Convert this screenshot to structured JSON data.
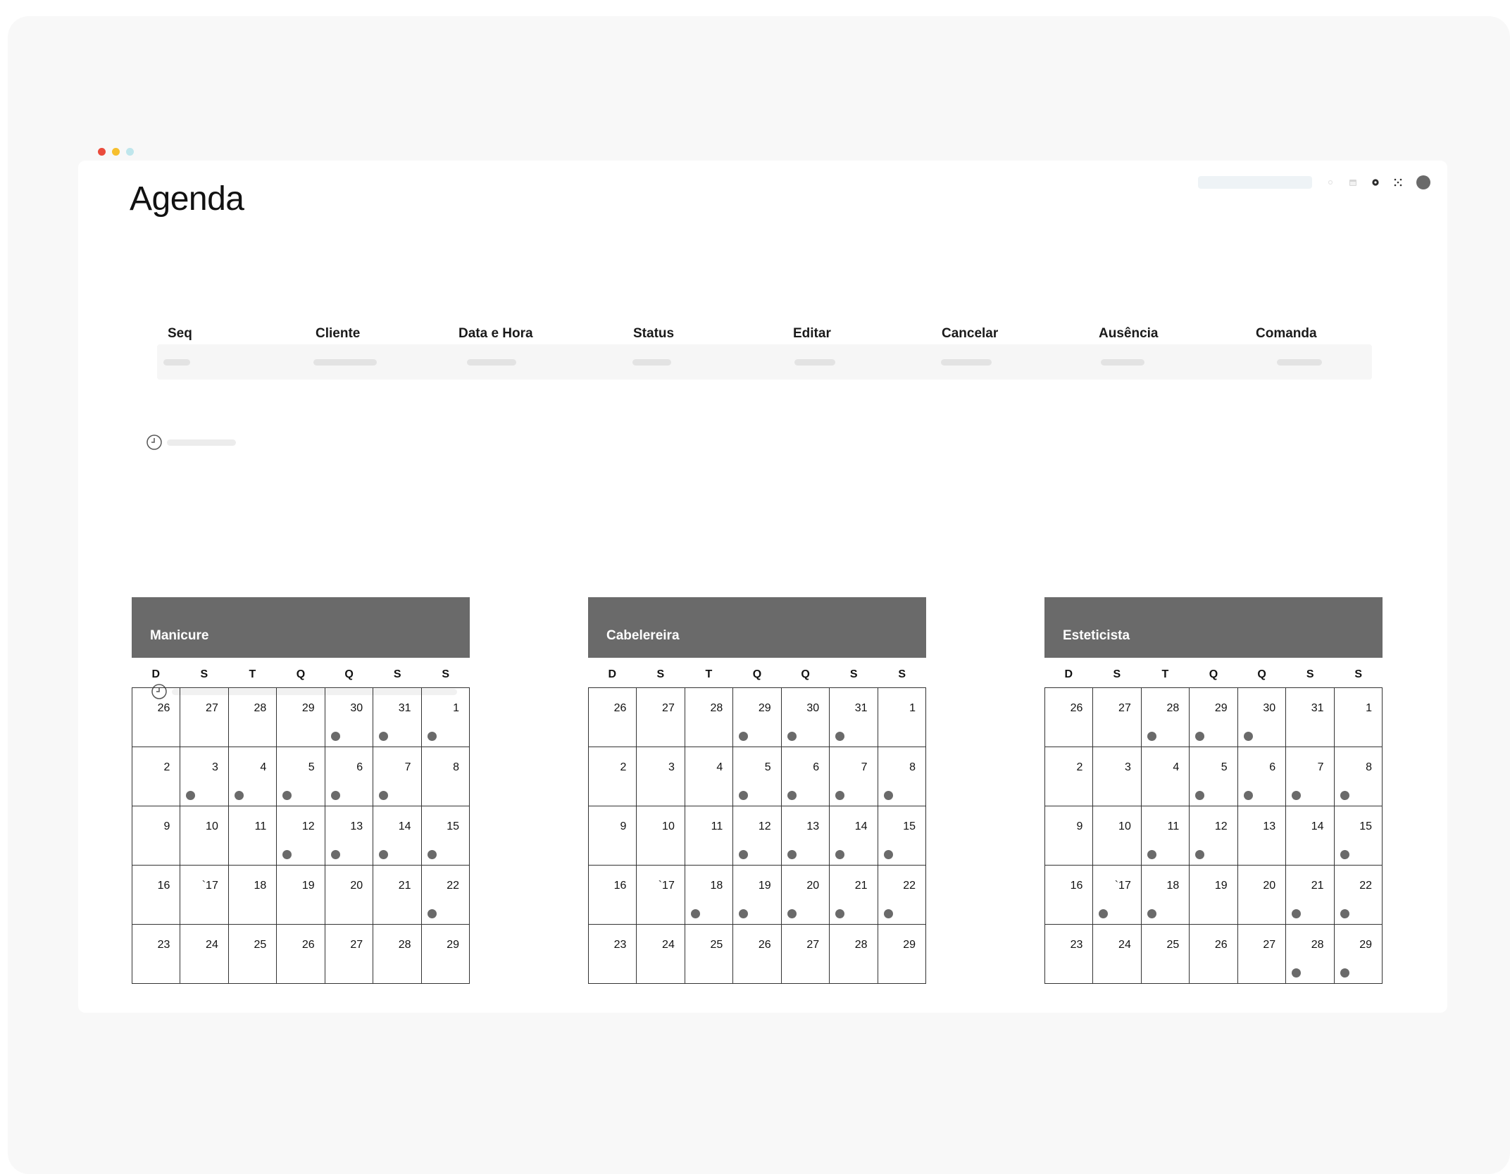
{
  "window": {
    "traffic_lights": [
      "#ea4b3c",
      "#f6bf2e",
      "#bfe6ec"
    ]
  },
  "toolbar": {
    "icons": [
      "sun-icon",
      "calendar-icon",
      "gear-icon",
      "expand-icon"
    ],
    "accent": "#6a6a6a"
  },
  "page": {
    "title": "Agenda"
  },
  "appointments": {
    "columns": [
      "Seq",
      "Cliente",
      "Data e Hora",
      "Status",
      "Editar",
      "Cancelar",
      "Ausência",
      "Comanda"
    ]
  },
  "calendars": [
    {
      "title": "Manicure",
      "weekdays": [
        "D",
        "S",
        "T",
        "Q",
        "Q",
        "S",
        "S"
      ],
      "days": [
        "26",
        "27",
        "28",
        "29",
        "30",
        "31",
        "1",
        "2",
        "3",
        "4",
        "5",
        "6",
        "7",
        "8",
        "9",
        "10",
        "11",
        "12",
        "13",
        "14",
        "15",
        "16",
        "`17",
        "18",
        "19",
        "20",
        "21",
        "22",
        "23",
        "24",
        "25",
        "26",
        "27",
        "28",
        "29"
      ],
      "marked": [
        false,
        false,
        false,
        false,
        true,
        true,
        true,
        false,
        true,
        true,
        true,
        true,
        true,
        false,
        false,
        false,
        false,
        true,
        true,
        true,
        true,
        false,
        false,
        false,
        false,
        false,
        false,
        true,
        false,
        false,
        false,
        false,
        false,
        false,
        false
      ]
    },
    {
      "title": "Cabelereira",
      "weekdays": [
        "D",
        "S",
        "T",
        "Q",
        "Q",
        "S",
        "S"
      ],
      "days": [
        "26",
        "27",
        "28",
        "29",
        "30",
        "31",
        "1",
        "2",
        "3",
        "4",
        "5",
        "6",
        "7",
        "8",
        "9",
        "10",
        "11",
        "12",
        "13",
        "14",
        "15",
        "16",
        "`17",
        "18",
        "19",
        "20",
        "21",
        "22",
        "23",
        "24",
        "25",
        "26",
        "27",
        "28",
        "29"
      ],
      "marked": [
        false,
        false,
        false,
        true,
        true,
        true,
        false,
        false,
        false,
        false,
        true,
        true,
        true,
        true,
        false,
        false,
        false,
        true,
        true,
        true,
        true,
        false,
        false,
        true,
        true,
        true,
        true,
        true,
        false,
        false,
        false,
        false,
        false,
        false,
        false
      ]
    },
    {
      "title": "Esteticista",
      "weekdays": [
        "D",
        "S",
        "T",
        "Q",
        "Q",
        "S",
        "S"
      ],
      "days": [
        "26",
        "27",
        "28",
        "29",
        "30",
        "31",
        "1",
        "2",
        "3",
        "4",
        "5",
        "6",
        "7",
        "8",
        "9",
        "10",
        "11",
        "12",
        "13",
        "14",
        "15",
        "16",
        "`17",
        "18",
        "19",
        "20",
        "21",
        "22",
        "23",
        "24",
        "25",
        "26",
        "27",
        "28",
        "29"
      ],
      "marked": [
        false,
        false,
        true,
        true,
        true,
        false,
        false,
        false,
        false,
        false,
        true,
        true,
        true,
        true,
        false,
        false,
        true,
        true,
        false,
        false,
        true,
        false,
        true,
        true,
        false,
        false,
        true,
        true,
        false,
        false,
        false,
        false,
        false,
        true,
        true
      ]
    }
  ]
}
